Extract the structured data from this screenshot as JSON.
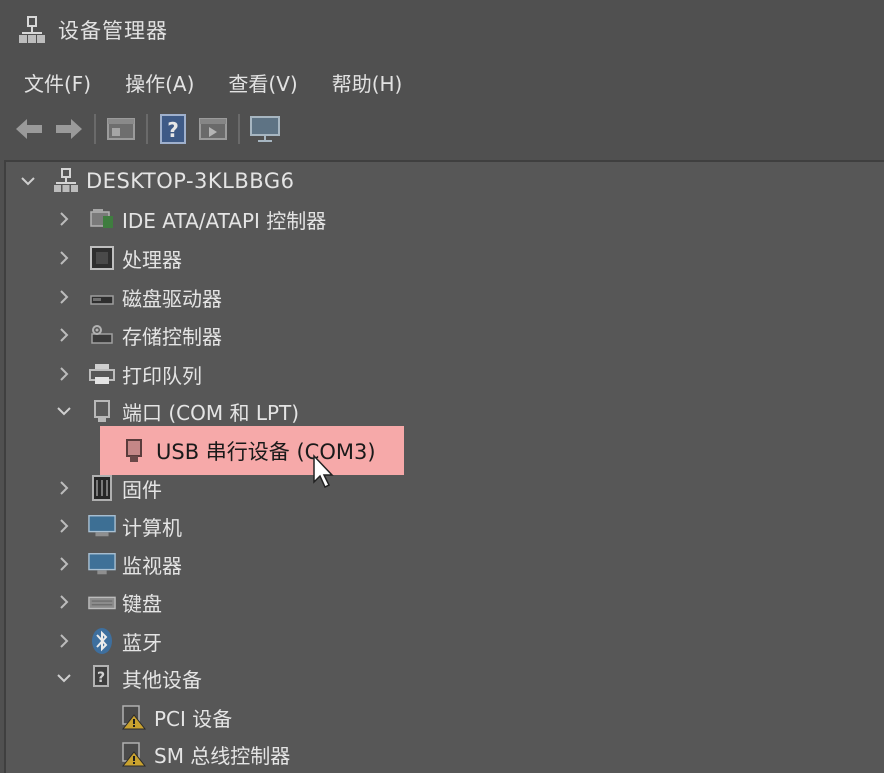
{
  "window": {
    "title": "设备管理器"
  },
  "menu": {
    "items": [
      {
        "label": "文件(F)"
      },
      {
        "label": "操作(A)"
      },
      {
        "label": "查看(V)"
      },
      {
        "label": "帮助(H)"
      }
    ]
  },
  "toolbar": {
    "buttons": [
      "back-arrow-icon",
      "forward-arrow-icon",
      "properties-icon",
      "help-icon",
      "run-icon",
      "monitor-icon"
    ]
  },
  "tree": {
    "root": {
      "label": "DESKTOP-3KLBBG6",
      "expanded": true
    },
    "items": [
      {
        "label": "IDE ATA/ATAPI 控制器",
        "expanded": false,
        "icon": "ide-controller-icon"
      },
      {
        "label": "处理器",
        "expanded": false,
        "icon": "processor-icon"
      },
      {
        "label": "磁盘驱动器",
        "expanded": false,
        "icon": "disk-drive-icon"
      },
      {
        "label": "存储控制器",
        "expanded": false,
        "icon": "storage-controller-icon"
      },
      {
        "label": "打印队列",
        "expanded": false,
        "icon": "printer-icon"
      },
      {
        "label": "端口 (COM 和 LPT)",
        "expanded": true,
        "icon": "port-icon"
      },
      {
        "label": "固件",
        "expanded": false,
        "icon": "firmware-icon"
      },
      {
        "label": "计算机",
        "expanded": false,
        "icon": "computer-icon"
      },
      {
        "label": "监视器",
        "expanded": false,
        "icon": "monitor-icon"
      },
      {
        "label": "键盘",
        "expanded": false,
        "icon": "keyboard-icon"
      },
      {
        "label": "蓝牙",
        "expanded": false,
        "icon": "bluetooth-icon"
      },
      {
        "label": "其他设备",
        "expanded": true,
        "icon": "other-devices-icon"
      }
    ],
    "port_children": [
      {
        "label": "USB 串行设备 (COM3)",
        "selected": true,
        "icon": "serial-port-icon"
      }
    ],
    "other_children": [
      {
        "label": "PCI 设备",
        "icon": "warning-device-icon"
      },
      {
        "label": "SM 总线控制器",
        "icon": "warning-device-icon"
      }
    ]
  },
  "colors": {
    "background": "#505050",
    "highlight": "#f6a9a9"
  }
}
